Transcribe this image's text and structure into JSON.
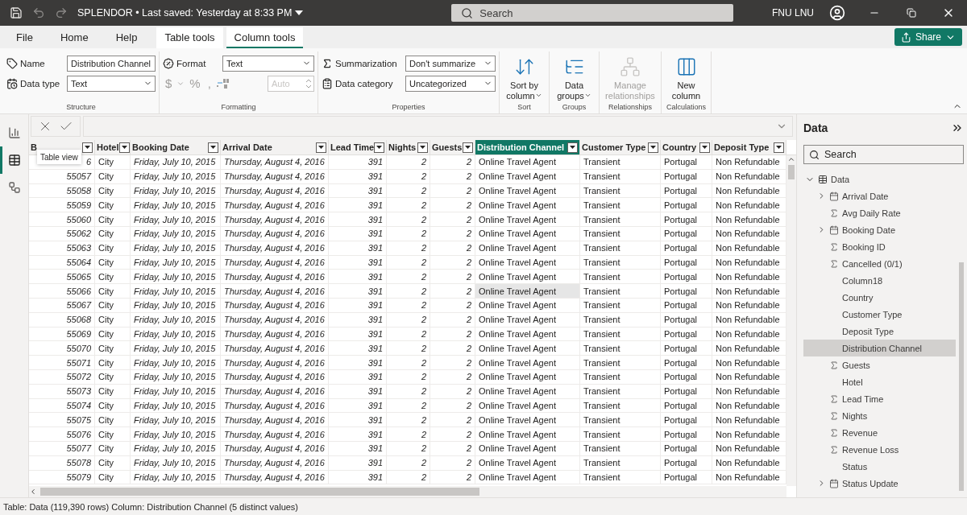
{
  "title_bar": {
    "title": "SPLENDOR • Last saved: Yesterday at 8:33 PM",
    "search_placeholder": "Search",
    "user": "FNU LNU"
  },
  "ribbon_tabs": [
    {
      "label": "File",
      "selected": false,
      "contextual": false
    },
    {
      "label": "Home",
      "selected": false,
      "contextual": false
    },
    {
      "label": "Help",
      "selected": false,
      "contextual": false
    },
    {
      "label": "Table tools",
      "selected": false,
      "contextual": true
    },
    {
      "label": "Column tools",
      "selected": true,
      "contextual": true
    }
  ],
  "share": "Share",
  "structure": {
    "label": "Structure",
    "name_label": "Name",
    "name_value": "Distribution Channel",
    "type_label": "Data type",
    "type_value": "Text"
  },
  "formatting": {
    "label": "Formatting",
    "format_label": "Format",
    "format_value": "Text",
    "symbols": [
      "$",
      "%",
      ","
    ],
    "decimals_placeholder": "Auto"
  },
  "properties": {
    "label": "Properties",
    "summarization_label": "Summarization",
    "summarization_value": "Don't summarize",
    "category_label": "Data category",
    "category_value": "Uncategorized"
  },
  "commands": [
    {
      "group": "Sort",
      "label": "Sort by column",
      "kind": "sort",
      "dropdown": true,
      "disabled": false
    },
    {
      "group": "Groups",
      "label": "Data groups",
      "kind": "groups",
      "dropdown": true,
      "disabled": false
    },
    {
      "group": "Relationships",
      "label": "Manage relationships",
      "kind": "relationships",
      "dropdown": false,
      "disabled": true
    },
    {
      "group": "Calculations",
      "label": "New column",
      "kind": "column",
      "dropdown": false,
      "disabled": false
    }
  ],
  "left_nav": [
    {
      "kind": "report",
      "selected": false
    },
    {
      "kind": "table",
      "selected": true
    },
    {
      "kind": "model",
      "selected": false
    }
  ],
  "tooltip": "Table view",
  "table": {
    "columns": [
      {
        "label": "B",
        "kind": "number",
        "selected": false
      },
      {
        "label": "Hotel",
        "kind": "text",
        "selected": false
      },
      {
        "label": "Booking Date",
        "kind": "date",
        "selected": false
      },
      {
        "label": "Arrival Date",
        "kind": "date",
        "selected": false
      },
      {
        "label": "Lead Time",
        "kind": "number",
        "selected": false
      },
      {
        "label": "Nights",
        "kind": "number",
        "selected": false
      },
      {
        "label": "Guests",
        "kind": "number",
        "selected": false
      },
      {
        "label": "Distribution Channel",
        "kind": "text",
        "selected": true
      },
      {
        "label": "Customer Type",
        "kind": "text",
        "selected": false
      },
      {
        "label": "Country",
        "kind": "text",
        "selected": false
      },
      {
        "label": "Deposit Type",
        "kind": "text",
        "selected": false
      }
    ],
    "rows": [
      {
        "hovered": false,
        "cells": [
          "6",
          "City",
          "Friday, July 10, 2015",
          "Thursday, August 4, 2016",
          "391",
          "2",
          "2",
          "Online Travel Agent",
          "Transient",
          "Portugal",
          "Non Refundable"
        ]
      },
      {
        "hovered": false,
        "cells": [
          "55057",
          "City",
          "Friday, July 10, 2015",
          "Thursday, August 4, 2016",
          "391",
          "2",
          "2",
          "Online Travel Agent",
          "Transient",
          "Portugal",
          "Non Refundable"
        ]
      },
      {
        "hovered": false,
        "cells": [
          "55058",
          "City",
          "Friday, July 10, 2015",
          "Thursday, August 4, 2016",
          "391",
          "2",
          "2",
          "Online Travel Agent",
          "Transient",
          "Portugal",
          "Non Refundable"
        ]
      },
      {
        "hovered": false,
        "cells": [
          "55059",
          "City",
          "Friday, July 10, 2015",
          "Thursday, August 4, 2016",
          "391",
          "2",
          "2",
          "Online Travel Agent",
          "Transient",
          "Portugal",
          "Non Refundable"
        ]
      },
      {
        "hovered": false,
        "cells": [
          "55060",
          "City",
          "Friday, July 10, 2015",
          "Thursday, August 4, 2016",
          "391",
          "2",
          "2",
          "Online Travel Agent",
          "Transient",
          "Portugal",
          "Non Refundable"
        ]
      },
      {
        "hovered": false,
        "cells": [
          "55062",
          "City",
          "Friday, July 10, 2015",
          "Thursday, August 4, 2016",
          "391",
          "2",
          "2",
          "Online Travel Agent",
          "Transient",
          "Portugal",
          "Non Refundable"
        ]
      },
      {
        "hovered": false,
        "cells": [
          "55063",
          "City",
          "Friday, July 10, 2015",
          "Thursday, August 4, 2016",
          "391",
          "2",
          "2",
          "Online Travel Agent",
          "Transient",
          "Portugal",
          "Non Refundable"
        ]
      },
      {
        "hovered": false,
        "cells": [
          "55064",
          "City",
          "Friday, July 10, 2015",
          "Thursday, August 4, 2016",
          "391",
          "2",
          "2",
          "Online Travel Agent",
          "Transient",
          "Portugal",
          "Non Refundable"
        ]
      },
      {
        "hovered": false,
        "cells": [
          "55065",
          "City",
          "Friday, July 10, 2015",
          "Thursday, August 4, 2016",
          "391",
          "2",
          "2",
          "Online Travel Agent",
          "Transient",
          "Portugal",
          "Non Refundable"
        ]
      },
      {
        "hovered": true,
        "cells": [
          "55066",
          "City",
          "Friday, July 10, 2015",
          "Thursday, August 4, 2016",
          "391",
          "2",
          "2",
          "Online Travel Agent",
          "Transient",
          "Portugal",
          "Non Refundable"
        ]
      },
      {
        "hovered": false,
        "cells": [
          "55067",
          "City",
          "Friday, July 10, 2015",
          "Thursday, August 4, 2016",
          "391",
          "2",
          "2",
          "Online Travel Agent",
          "Transient",
          "Portugal",
          "Non Refundable"
        ]
      },
      {
        "hovered": false,
        "cells": [
          "55068",
          "City",
          "Friday, July 10, 2015",
          "Thursday, August 4, 2016",
          "391",
          "2",
          "2",
          "Online Travel Agent",
          "Transient",
          "Portugal",
          "Non Refundable"
        ]
      },
      {
        "hovered": false,
        "cells": [
          "55069",
          "City",
          "Friday, July 10, 2015",
          "Thursday, August 4, 2016",
          "391",
          "2",
          "2",
          "Online Travel Agent",
          "Transient",
          "Portugal",
          "Non Refundable"
        ]
      },
      {
        "hovered": false,
        "cells": [
          "55070",
          "City",
          "Friday, July 10, 2015",
          "Thursday, August 4, 2016",
          "391",
          "2",
          "2",
          "Online Travel Agent",
          "Transient",
          "Portugal",
          "Non Refundable"
        ]
      },
      {
        "hovered": false,
        "cells": [
          "55071",
          "City",
          "Friday, July 10, 2015",
          "Thursday, August 4, 2016",
          "391",
          "2",
          "2",
          "Online Travel Agent",
          "Transient",
          "Portugal",
          "Non Refundable"
        ]
      },
      {
        "hovered": false,
        "cells": [
          "55072",
          "City",
          "Friday, July 10, 2015",
          "Thursday, August 4, 2016",
          "391",
          "2",
          "2",
          "Online Travel Agent",
          "Transient",
          "Portugal",
          "Non Refundable"
        ]
      },
      {
        "hovered": false,
        "cells": [
          "55073",
          "City",
          "Friday, July 10, 2015",
          "Thursday, August 4, 2016",
          "391",
          "2",
          "2",
          "Online Travel Agent",
          "Transient",
          "Portugal",
          "Non Refundable"
        ]
      },
      {
        "hovered": false,
        "cells": [
          "55074",
          "City",
          "Friday, July 10, 2015",
          "Thursday, August 4, 2016",
          "391",
          "2",
          "2",
          "Online Travel Agent",
          "Transient",
          "Portugal",
          "Non Refundable"
        ]
      },
      {
        "hovered": false,
        "cells": [
          "55075",
          "City",
          "Friday, July 10, 2015",
          "Thursday, August 4, 2016",
          "391",
          "2",
          "2",
          "Online Travel Agent",
          "Transient",
          "Portugal",
          "Non Refundable"
        ]
      },
      {
        "hovered": false,
        "cells": [
          "55076",
          "City",
          "Friday, July 10, 2015",
          "Thursday, August 4, 2016",
          "391",
          "2",
          "2",
          "Online Travel Agent",
          "Transient",
          "Portugal",
          "Non Refundable"
        ]
      },
      {
        "hovered": false,
        "cells": [
          "55077",
          "City",
          "Friday, July 10, 2015",
          "Thursday, August 4, 2016",
          "391",
          "2",
          "2",
          "Online Travel Agent",
          "Transient",
          "Portugal",
          "Non Refundable"
        ]
      },
      {
        "hovered": false,
        "cells": [
          "55078",
          "City",
          "Friday, July 10, 2015",
          "Thursday, August 4, 2016",
          "391",
          "2",
          "2",
          "Online Travel Agent",
          "Transient",
          "Portugal",
          "Non Refundable"
        ]
      },
      {
        "hovered": false,
        "cells": [
          "55079",
          "City",
          "Friday, July 10, 2015",
          "Thursday, August 4, 2016",
          "391",
          "2",
          "2",
          "Online Travel Agent",
          "Transient",
          "Portugal",
          "Non Refundable"
        ]
      }
    ]
  },
  "data_pane": {
    "title": "Data",
    "search_placeholder": "Search",
    "table_label": "Data",
    "expanded": true,
    "fields": [
      {
        "label": "Arrival Date",
        "kind": "date",
        "expanded": false,
        "selected": false
      },
      {
        "label": "Avg Daily Rate",
        "kind": "measure",
        "selected": false
      },
      {
        "label": "Booking Date",
        "kind": "date",
        "expanded": false,
        "selected": false
      },
      {
        "label": "Booking ID",
        "kind": "measure",
        "selected": false
      },
      {
        "label": "Cancelled (0/1)",
        "kind": "measure",
        "selected": false
      },
      {
        "label": "Column18",
        "kind": "text",
        "selected": false
      },
      {
        "label": "Country",
        "kind": "text",
        "selected": false
      },
      {
        "label": "Customer Type",
        "kind": "text",
        "selected": false
      },
      {
        "label": "Deposit Type",
        "kind": "text",
        "selected": false
      },
      {
        "label": "Distribution Channel",
        "kind": "text",
        "selected": true
      },
      {
        "label": "Guests",
        "kind": "measure",
        "selected": false
      },
      {
        "label": "Hotel",
        "kind": "text",
        "selected": false
      },
      {
        "label": "Lead Time",
        "kind": "measure",
        "selected": false
      },
      {
        "label": "Nights",
        "kind": "measure",
        "selected": false
      },
      {
        "label": "Revenue",
        "kind": "measure",
        "selected": false
      },
      {
        "label": "Revenue Loss",
        "kind": "measure",
        "selected": false
      },
      {
        "label": "Status",
        "kind": "text",
        "selected": false
      },
      {
        "label": "Status Update",
        "kind": "date",
        "expanded": false,
        "selected": false
      }
    ]
  },
  "status_bar": "Table: Data (119,390 rows) Column: Distribution Channel (5 distinct values)"
}
